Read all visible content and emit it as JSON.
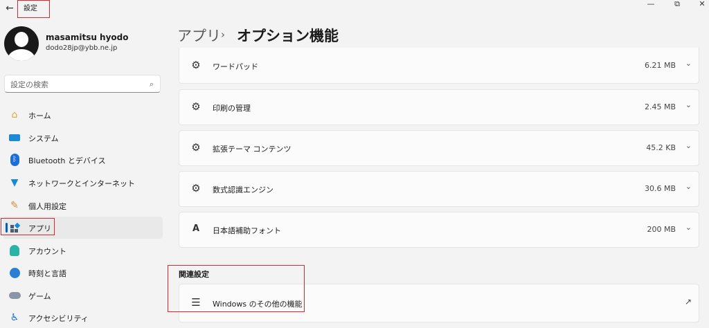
{
  "window": {
    "title": "設定",
    "back_icon": "back-arrow-icon",
    "controls": [
      "minimize-icon",
      "restore-icon",
      "close-icon"
    ]
  },
  "profile": {
    "name": "masamitsu hyodo",
    "email": "dodo28jp@ybb.ne.jp"
  },
  "search": {
    "placeholder": "設定の検索"
  },
  "sidebar": {
    "items": [
      {
        "label": "ホーム",
        "icon": "home-icon",
        "active": false
      },
      {
        "label": "システム",
        "icon": "system-icon",
        "active": false
      },
      {
        "label": "Bluetooth とデバイス",
        "icon": "bluetooth-icon",
        "active": false
      },
      {
        "label": "ネットワークとインターネット",
        "icon": "wifi-icon",
        "active": false
      },
      {
        "label": "個人用設定",
        "icon": "brush-icon",
        "active": false
      },
      {
        "label": "アプリ",
        "icon": "apps-icon",
        "active": true
      },
      {
        "label": "アカウント",
        "icon": "account-icon",
        "active": false
      },
      {
        "label": "時刻と言語",
        "icon": "globe-icon",
        "active": false
      },
      {
        "label": "ゲーム",
        "icon": "gamepad-icon",
        "active": false
      },
      {
        "label": "アクセシビリティ",
        "icon": "accessibility-icon",
        "active": false
      }
    ]
  },
  "header": {
    "parent": "アプリ",
    "separator": "›",
    "current": "オプション機能"
  },
  "features": [
    {
      "name": "ワードパッド",
      "size": "6.21 MB",
      "icon": "puzzle-icon"
    },
    {
      "name": "印刷の管理",
      "size": "2.45 MB",
      "icon": "puzzle-icon"
    },
    {
      "name": "拡張テーマ コンテンツ",
      "size": "45.2 KB",
      "icon": "puzzle-icon"
    },
    {
      "name": "数式認識エンジン",
      "size": "30.6 MB",
      "icon": "puzzle-icon"
    },
    {
      "name": "日本語補助フォント",
      "size": "200 MB",
      "icon": "font-icon"
    }
  ],
  "related": {
    "title": "関連設定",
    "link_label": "Windows のその他の機能",
    "link_icon": "list-icon",
    "external_icon": "external-link-icon"
  },
  "colors": {
    "accent": "#005fb8",
    "highlight_box": "#e0242b",
    "background": "#f3f3f3",
    "card": "#fbfbfb"
  }
}
